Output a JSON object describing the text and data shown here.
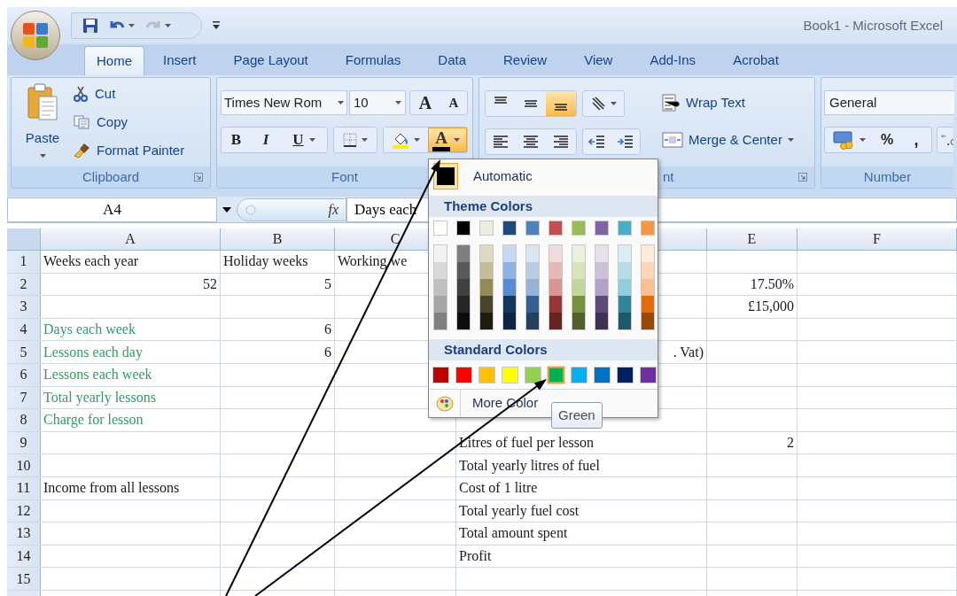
{
  "window": {
    "title": "Book1 - Microsoft Excel"
  },
  "quick_access": [
    {
      "kind": "save",
      "disabled": false
    },
    {
      "kind": "undo",
      "disabled": false
    },
    {
      "kind": "redo",
      "disabled": true
    }
  ],
  "tabs": [
    {
      "label": "Home",
      "selected": true
    },
    {
      "label": "Insert",
      "selected": false
    },
    {
      "label": "Page Layout",
      "selected": false
    },
    {
      "label": "Formulas",
      "selected": false
    },
    {
      "label": "Data",
      "selected": false
    },
    {
      "label": "Review",
      "selected": false
    },
    {
      "label": "View",
      "selected": false
    },
    {
      "label": "Add-Ins",
      "selected": false
    },
    {
      "label": "Acrobat",
      "selected": false
    }
  ],
  "ribbon": {
    "clipboard": {
      "label": "Clipboard",
      "paste": "Paste",
      "cut": "Cut",
      "copy": "Copy",
      "format_painter": "Format Painter"
    },
    "font": {
      "label": "Font",
      "font_name": "Times New Rom",
      "font_size": "10",
      "grow": "A",
      "shrink": "A",
      "bold": "B",
      "italic": "I",
      "underline": "U",
      "font_color": "A",
      "font_color_open": true
    },
    "alignment": {
      "label": "nt",
      "vertical": [
        {
          "kind": "top",
          "selected": false
        },
        {
          "kind": "middle",
          "selected": false
        },
        {
          "kind": "bottom",
          "selected": true
        }
      ],
      "wrap_text": "Wrap Text",
      "merge_center": "Merge & Center"
    },
    "number": {
      "label": "Number",
      "format": "General",
      "percent": "%",
      "comma": ","
    }
  },
  "formula_bar": {
    "name_box": "A4",
    "function_label": "fx",
    "value": "Days each"
  },
  "column_headers": {
    "a": "A",
    "b": "B",
    "c": "C",
    "e": "E",
    "f": "F"
  },
  "rows": [
    {
      "number": "1",
      "cells": {
        "a": {
          "text": "Weeks each year",
          "kind": "text"
        },
        "b": {
          "text": "Holiday weeks",
          "kind": "text"
        },
        "c": {
          "text": "Working we",
          "kind": "text"
        }
      }
    },
    {
      "number": "2",
      "cells": {
        "a": {
          "text": "52",
          "kind": "number"
        },
        "b": {
          "text": "5",
          "kind": "number"
        },
        "e": {
          "text": "17.50%",
          "kind": "number"
        }
      }
    },
    {
      "number": "3",
      "cells": {
        "e": {
          "text": "£15,000",
          "kind": "number"
        }
      }
    },
    {
      "number": "4",
      "cells": {
        "a": {
          "text": "Days each week",
          "kind": "text",
          "color": "#339966"
        },
        "b": {
          "text": "6",
          "kind": "number"
        }
      }
    },
    {
      "number": "5",
      "cells": {
        "a": {
          "text": "Lessons each day",
          "kind": "text",
          "color": "#339966"
        },
        "b": {
          "text": "6",
          "kind": "number"
        },
        "d": {
          "text": ". Vat)",
          "kind": "number"
        }
      }
    },
    {
      "number": "6",
      "cells": {
        "a": {
          "text": "Lessons each week",
          "kind": "text",
          "color": "#339966"
        }
      }
    },
    {
      "number": "7",
      "cells": {
        "a": {
          "text": "Total yearly lessons",
          "kind": "text",
          "color": "#339966"
        }
      }
    },
    {
      "number": "8",
      "cells": {
        "a": {
          "text": "Charge for lesson",
          "kind": "text",
          "color": "#339966"
        }
      }
    },
    {
      "number": "9",
      "cells": {
        "d": {
          "text": "Litres of fuel per lesson",
          "kind": "text"
        },
        "e": {
          "text": "2",
          "kind": "number"
        }
      }
    },
    {
      "number": "10",
      "cells": {
        "d": {
          "text": "Total yearly litres of fuel",
          "kind": "text"
        }
      }
    },
    {
      "number": "11",
      "cells": {
        "a": {
          "text": "Income from all lessons",
          "kind": "text"
        },
        "d": {
          "text": "Cost of 1 litre",
          "kind": "text"
        }
      }
    },
    {
      "number": "12",
      "cells": {
        "d": {
          "text": "Total yearly fuel cost",
          "kind": "text"
        }
      }
    },
    {
      "number": "13",
      "cells": {
        "d": {
          "text": "Total amount spent",
          "kind": "text"
        }
      }
    },
    {
      "number": "14",
      "cells": {
        "d": {
          "text": "Profit",
          "kind": "text"
        }
      }
    },
    {
      "number": "15",
      "cells": {}
    }
  ],
  "font_color_menu": {
    "automatic": "Automatic",
    "theme_header": "Theme Colors",
    "theme_colors": [
      {
        "color": "#ffffff",
        "shades": [
          {
            "color": "#f2f2f2"
          },
          {
            "color": "#d9d9d9"
          },
          {
            "color": "#bfbfbf"
          },
          {
            "color": "#a6a6a6"
          },
          {
            "color": "#808080"
          }
        ]
      },
      {
        "color": "#000000",
        "shades": [
          {
            "color": "#7f7f7f"
          },
          {
            "color": "#595959"
          },
          {
            "color": "#404040"
          },
          {
            "color": "#262626"
          },
          {
            "color": "#0d0d0d"
          }
        ]
      },
      {
        "color": "#eeece1",
        "shades": [
          {
            "color": "#ddd9c3"
          },
          {
            "color": "#c4bd97"
          },
          {
            "color": "#948a54"
          },
          {
            "color": "#4a452a"
          },
          {
            "color": "#1e1c11"
          }
        ]
      },
      {
        "color": "#1f497d",
        "shades": [
          {
            "color": "#c6d9f0"
          },
          {
            "color": "#8db3e2"
          },
          {
            "color": "#548dd4"
          },
          {
            "color": "#17365d"
          },
          {
            "color": "#0f243e"
          }
        ]
      },
      {
        "color": "#4f81bd",
        "shades": [
          {
            "color": "#dbe5f1"
          },
          {
            "color": "#b8cce4"
          },
          {
            "color": "#95b3d7"
          },
          {
            "color": "#366092"
          },
          {
            "color": "#244061"
          }
        ]
      },
      {
        "color": "#c0504d",
        "shades": [
          {
            "color": "#f2dcdb"
          },
          {
            "color": "#e5b9b7"
          },
          {
            "color": "#d99694"
          },
          {
            "color": "#953734"
          },
          {
            "color": "#632423"
          }
        ]
      },
      {
        "color": "#9bbb59",
        "shades": [
          {
            "color": "#ebf1dd"
          },
          {
            "color": "#d7e3bc"
          },
          {
            "color": "#c3d69b"
          },
          {
            "color": "#76923c"
          },
          {
            "color": "#4f6128"
          }
        ]
      },
      {
        "color": "#8064a2",
        "shades": [
          {
            "color": "#e5e0ec"
          },
          {
            "color": "#ccc1d9"
          },
          {
            "color": "#b2a2c7"
          },
          {
            "color": "#5f497a"
          },
          {
            "color": "#3f3151"
          }
        ]
      },
      {
        "color": "#4bacc6",
        "shades": [
          {
            "color": "#dbeef3"
          },
          {
            "color": "#b7dde8"
          },
          {
            "color": "#92cddc"
          },
          {
            "color": "#31859b"
          },
          {
            "color": "#205867"
          }
        ]
      },
      {
        "color": "#f79646",
        "shades": [
          {
            "color": "#fdeada"
          },
          {
            "color": "#fbd5b5"
          },
          {
            "color": "#fac08f"
          },
          {
            "color": "#e36c09"
          },
          {
            "color": "#974806"
          }
        ]
      }
    ],
    "standard_header": "Standard Colors",
    "standard_colors": [
      {
        "color": "#c00000",
        "selected": false
      },
      {
        "color": "#ff0000",
        "selected": false
      },
      {
        "color": "#ffc000",
        "selected": false
      },
      {
        "color": "#ffff00",
        "selected": false
      },
      {
        "color": "#92d050",
        "selected": false
      },
      {
        "color": "#00b050",
        "selected": true
      },
      {
        "color": "#00b0f0",
        "selected": false
      },
      {
        "color": "#0070c0",
        "selected": false
      },
      {
        "color": "#002060",
        "selected": false
      },
      {
        "color": "#7030a0",
        "selected": false
      }
    ],
    "more_colors": "More Color",
    "tooltip": "Green"
  }
}
